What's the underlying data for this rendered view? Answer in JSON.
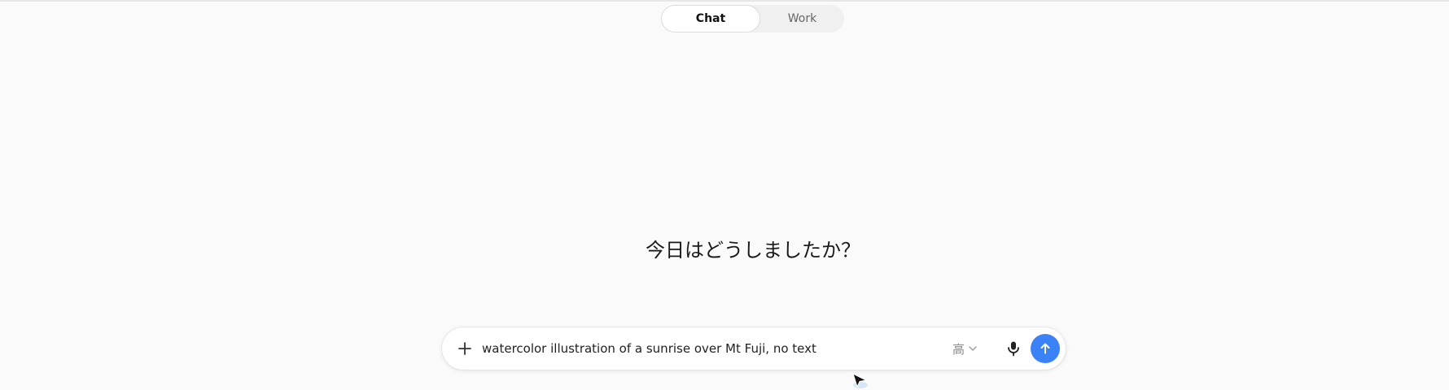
{
  "mode_toggle": {
    "tabs": [
      {
        "label": "Chat",
        "active": true
      },
      {
        "label": "Work",
        "active": false
      }
    ]
  },
  "greeting": "今日はどうしましたか？",
  "composer": {
    "input_value": "watercolor illustration of a sunrise over Mt Fuji, no text",
    "quality_label": "高",
    "add_icon": "plus-icon",
    "quality_icon": "chevron-down-icon",
    "mic_icon": "microphone-icon",
    "send_icon": "arrow-up-icon",
    "send_color": "#3b82f6"
  }
}
